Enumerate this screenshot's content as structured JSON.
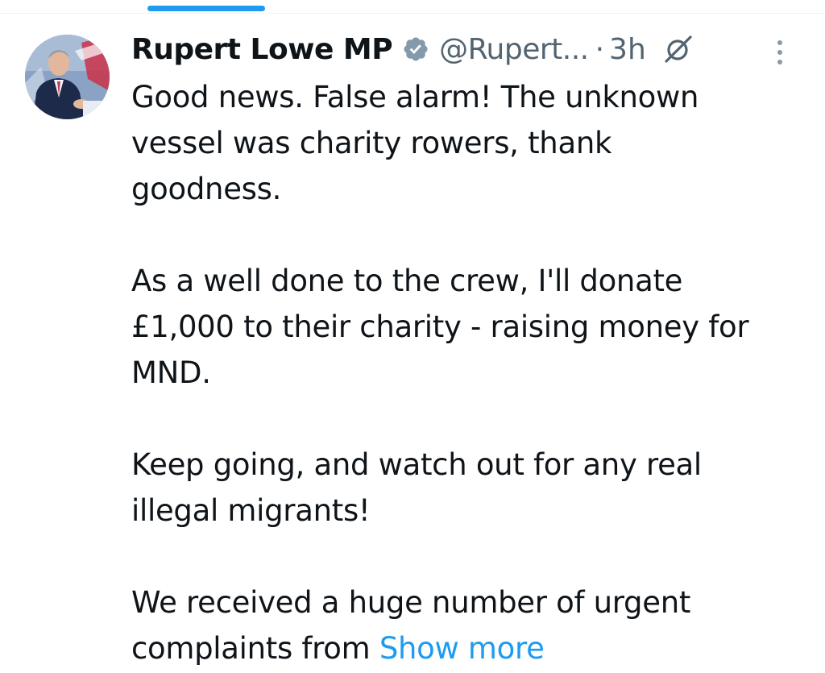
{
  "author": {
    "name": "Rupert Lowe MP",
    "handle": "@Rupert...",
    "separator": "·",
    "time": "3h"
  },
  "tweet": {
    "line_1": "Good news. False alarm! The unknown",
    "line_2": "vessel was charity rowers, thank",
    "line_3": "goodness.",
    "line_4": "As a well done to the crew, I'll donate",
    "line_5": "£1,000 to their charity - raising money for",
    "line_6": "MND.",
    "line_7": "Keep going, and watch out for any real",
    "line_8": "illegal migrants!",
    "line_9": "We received a huge number of urgent",
    "line_10": "complaints from",
    "show_more": "Show more"
  },
  "icons": {
    "verified": "verified-badge-icon",
    "grok": "grok-icon",
    "more": "more-options-icon"
  },
  "colors": {
    "accent": "#1d9bf0",
    "text": "#0f1419",
    "secondary_text": "#536471"
  }
}
